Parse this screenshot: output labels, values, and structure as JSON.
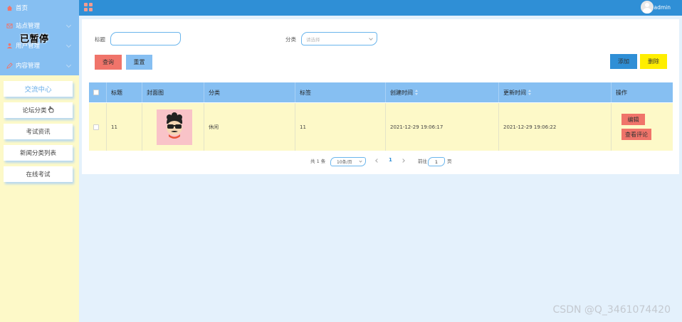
{
  "sidebar": {
    "home": "首页",
    "menus": [
      "站点管理",
      "用户管理",
      "内容管理"
    ],
    "paused_overlay": "已暂停",
    "submenu": [
      {
        "label": "交流中心",
        "active": true
      },
      {
        "label": "论坛分类",
        "active": false
      },
      {
        "label": "考试资讯",
        "active": false
      },
      {
        "label": "新闻分类列表",
        "active": false
      },
      {
        "label": "在线考试",
        "active": false
      }
    ]
  },
  "header": {
    "username": "admin",
    "accent": "#2f8fd6"
  },
  "filters": {
    "title_label": "标题",
    "title_value": "",
    "category_label": "分类",
    "category_placeholder": "请选择"
  },
  "toolbar": {
    "query": "查询",
    "reset": "重置",
    "add": "添加",
    "delete": "删除"
  },
  "table": {
    "headers": [
      "标题",
      "封面图",
      "分类",
      "标签",
      "创建时间",
      "更新时间",
      "操作"
    ],
    "rows": [
      {
        "title": "11",
        "category": "休闲",
        "tag": "11",
        "created": "2021-12-29 19:06:17",
        "updated": "2021-12-29 19:06:22",
        "edit": "编辑",
        "view_comments": "查看评论"
      }
    ]
  },
  "pagination": {
    "total": "共 1 条",
    "page_size": "10条/页",
    "current_page": "1",
    "goto_prefix": "前往",
    "goto_value": "1",
    "goto_suffix": "页"
  },
  "watermark": "CSDN @Q_3461074420"
}
